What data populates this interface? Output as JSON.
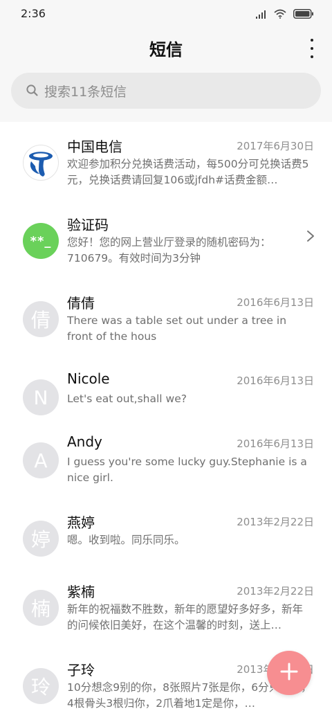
{
  "status_bar": {
    "time": "2:36",
    "icons": [
      "signal-icon",
      "wifi-icon",
      "battery-icon"
    ]
  },
  "header": {
    "title": "短信",
    "more_icon": "more-vertical-icon"
  },
  "search": {
    "placeholder": "搜索11条短信",
    "icon": "search-icon"
  },
  "messages": [
    {
      "name": "中国电信",
      "date": "2017年6月30日",
      "preview": "欢迎参加积分兑换话费活动，每500分可兑换话费5元，兑换话费请回复106或jfdh#话费金额…",
      "avatar": {
        "type": "logo",
        "icon": "china-telecom-logo"
      }
    },
    {
      "name": "验证码",
      "date": "",
      "preview": "您好！您的网上营业厅登录的随机密码为：710679。有效时间为3分钟",
      "avatar": {
        "type": "code",
        "text": "**_"
      }
    },
    {
      "name": "倩倩",
      "date": "2016年6月13日",
      "preview": "There was a table set out under a tree in front of the hous",
      "avatar": {
        "type": "letter",
        "text": "倩"
      }
    },
    {
      "name": "Nicole",
      "date": "2016年6月13日",
      "preview": "Let's eat out,shall we?",
      "avatar": {
        "type": "letter",
        "text": "N"
      }
    },
    {
      "name": "Andy",
      "date": "2016年6月13日",
      "preview": "I guess you're some lucky guy.Stephanie is a nice girl.",
      "avatar": {
        "type": "letter",
        "text": "A"
      }
    },
    {
      "name": "燕婷",
      "date": "2013年2月22日",
      "preview": "嗯。收到啦。同乐同乐。",
      "avatar": {
        "type": "letter",
        "text": "婷"
      }
    },
    {
      "name": "紫楠",
      "date": "2013年2月22日",
      "preview": "新年的祝福数不胜数，新年的愿望好多好多，新年的问候依旧美好，在这个温馨的时刻，送上…",
      "avatar": {
        "type": "letter",
        "text": "楠"
      }
    },
    {
      "name": "子玲",
      "date": "2013年2月22日",
      "preview": "10分想念9别的你，8张照片7张是你，6分只像你，4根骨头3根归你，2爪着地1定是你，…",
      "avatar": {
        "type": "letter",
        "text": "玲"
      }
    }
  ],
  "fab": {
    "icon": "plus-icon"
  },
  "colors": {
    "background": "#f7f7f7",
    "search_bg": "#e9e9e9",
    "avatar_grey": "#e3e3e6",
    "code_green": "#6ad15a",
    "fab_pink": "#f78e91",
    "telecom_blue": "#1c5cb0"
  }
}
